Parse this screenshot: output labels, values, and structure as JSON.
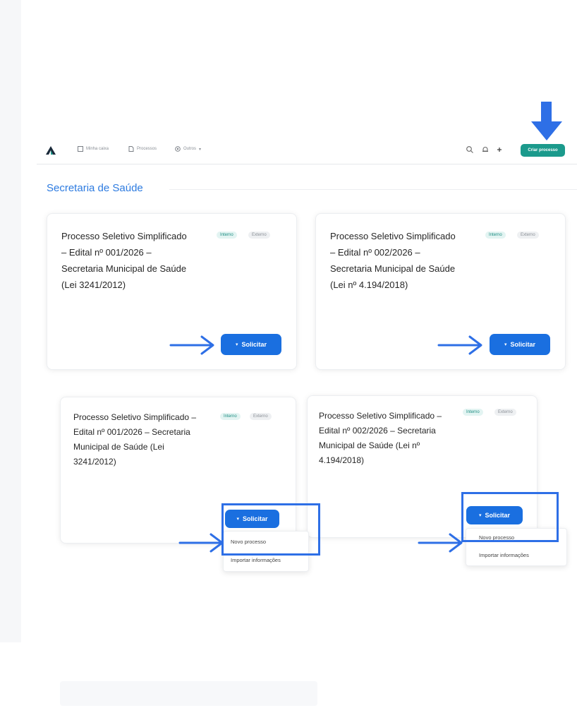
{
  "nav": {
    "items": [
      {
        "label": "Minha caixa",
        "icon": "inbox-icon"
      },
      {
        "label": "Processos",
        "icon": "document-icon"
      },
      {
        "label": "Outros",
        "icon": "grid-icon"
      }
    ],
    "create_button": "Criar processo",
    "icons": [
      "search-icon",
      "bell-icon",
      "plus-icon"
    ]
  },
  "section": {
    "title": "Secretaria de Saúde"
  },
  "cards": [
    {
      "title": "Processo Seletivo Simplificado – Edital nº 001/2026 – Secretaria Municipal de Saúde (Lei 3241/2012)",
      "tag_internal": "Interno",
      "tag_external": "Externo",
      "button": "Solicitar"
    },
    {
      "title": "Processo Seletivo Simplificado – Edital nº 002/2026 – Secretaria Municipal de Saúde (Lei nº 4.194/2018)",
      "tag_internal": "Interno",
      "tag_external": "Externo",
      "button": "Solicitar"
    },
    {
      "title": "Processo Seletivo Simplificado – Edital nº 001/2026 – Secretaria Municipal de Saúde (Lei 3241/2012)",
      "tag_internal": "Interno",
      "tag_external": "Externo",
      "button": "Solicitar"
    },
    {
      "title": "Processo Seletivo Simplificado – Edital nº 002/2026 – Secretaria Municipal de Saúde (Lei nº 4.194/2018)",
      "tag_internal": "Interno",
      "tag_external": "Externo",
      "button": "Solicitar"
    }
  ],
  "dropdown": {
    "items": [
      "Novo processo",
      "Importar informações"
    ]
  },
  "colors": {
    "accent": "#1a6fe0",
    "create_button": "#1b9a8c",
    "annotation": "#2e6fe6",
    "section_title": "#2d7be0"
  }
}
